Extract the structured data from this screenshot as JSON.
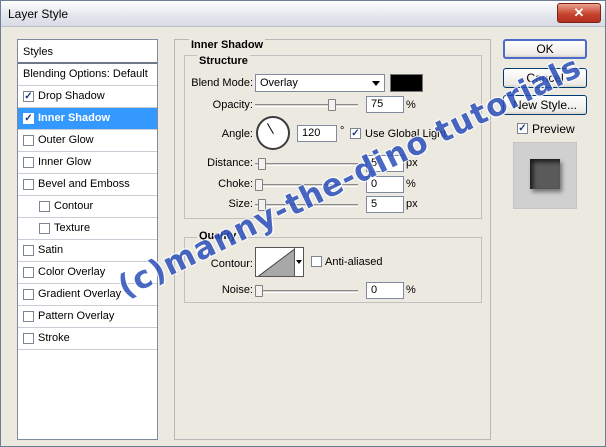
{
  "window": {
    "title": "Layer Style",
    "close_glyph": "✕"
  },
  "styles_panel": {
    "header": "Styles",
    "blending": "Blending Options: Default",
    "items": [
      {
        "label": "Drop Shadow",
        "checked": true
      },
      {
        "label": "Inner Shadow",
        "checked": true,
        "selected": true
      },
      {
        "label": "Outer Glow",
        "checked": false
      },
      {
        "label": "Inner Glow",
        "checked": false
      },
      {
        "label": "Bevel and Emboss",
        "checked": false
      },
      {
        "label": "Contour",
        "checked": false
      },
      {
        "label": "Texture",
        "checked": false
      },
      {
        "label": "Satin",
        "checked": false
      },
      {
        "label": "Color Overlay",
        "checked": false
      },
      {
        "label": "Gradient Overlay",
        "checked": false
      },
      {
        "label": "Pattern Overlay",
        "checked": false
      },
      {
        "label": "Stroke",
        "checked": false
      }
    ],
    "check_glyph": "✓"
  },
  "inner_shadow": {
    "title": "Inner Shadow",
    "structure": {
      "title": "Structure",
      "blend_mode_label": "Blend Mode:",
      "blend_mode_value": "Overlay",
      "color": "#000000",
      "opacity_label": "Opacity:",
      "opacity_value": "75",
      "opacity_unit": "%",
      "opacity_level": 0.75,
      "angle_label": "Angle:",
      "angle_value": "120",
      "angle_unit": "°",
      "global_light_label": "Use Global Light",
      "global_light_checked": true,
      "distance_label": "Distance:",
      "distance_value": "5",
      "distance_unit": "px",
      "choke_label": "Choke:",
      "choke_value": "0",
      "choke_unit": "%",
      "size_label": "Size:",
      "size_value": "5",
      "size_unit": "px"
    },
    "quality": {
      "title": "Quality",
      "contour_label": "Contour:",
      "anti_aliased_label": "Anti-aliased",
      "anti_aliased_checked": false,
      "noise_label": "Noise:",
      "noise_value": "0",
      "noise_unit": "%"
    }
  },
  "buttons": {
    "ok": "OK",
    "cancel": "Cancel",
    "new_style": "New Style..."
  },
  "preview": {
    "label": "Preview",
    "checked": true
  },
  "watermark": "(c)manny-the-dino tutorials"
}
